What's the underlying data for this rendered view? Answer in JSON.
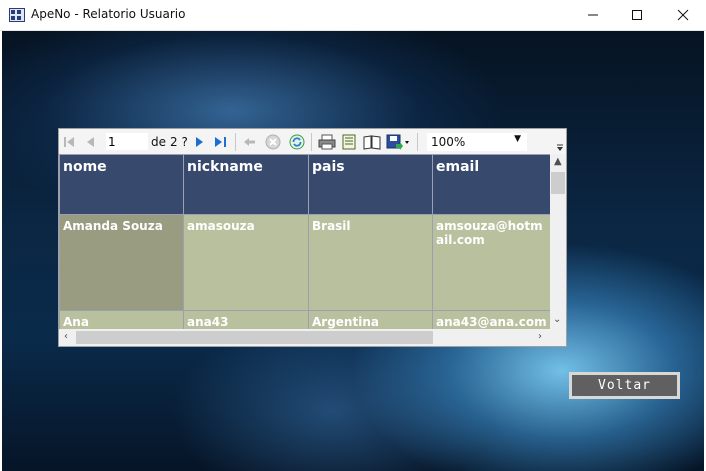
{
  "window": {
    "title": "ApeNo - Relatorio Usuario",
    "controls": [
      "minimize",
      "maximize",
      "close"
    ]
  },
  "toolbar": {
    "page_current": "1",
    "page_of_label": "de",
    "page_total": "2 ?",
    "zoom": "100%",
    "icons": [
      "first-page-icon",
      "previous-page-icon",
      "next-page-icon",
      "last-page-icon",
      "back-icon",
      "stop-icon",
      "refresh-icon",
      "print-icon",
      "print-layout-icon",
      "page-setup-icon",
      "export-icon",
      "zoom-dropdown-icon"
    ]
  },
  "report": {
    "columns": [
      "nome",
      "nickname",
      "pais",
      "email"
    ],
    "rows": [
      [
        "Amanda Souza",
        "amasouza",
        "Brasil",
        "amsouza@hotmail.com"
      ],
      [
        "Ana",
        "ana43",
        "Argentina",
        "ana43@ana.com"
      ]
    ],
    "colors": {
      "header": "#37496c",
      "cell": "#b9c09e",
      "cell_first": "#999c80"
    }
  },
  "buttons": {
    "back_label": "Voltar"
  }
}
